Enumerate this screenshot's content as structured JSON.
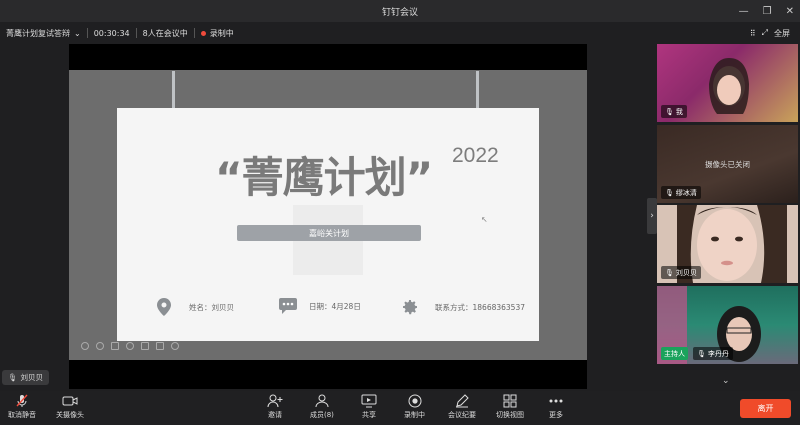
{
  "window": {
    "title": "钉钉会议"
  },
  "infobar": {
    "meeting_name": "菁鹰计划复试答辩",
    "duration": "00:30:34",
    "participants_text": "8人在会议中",
    "recording_text": "录制中",
    "fullscreen_label": "全屏"
  },
  "slide": {
    "title": "“菁鹰计划”",
    "year": "2022",
    "subtitle": "嘉峪关计划",
    "name_text": "姓名：刘贝贝",
    "date_text": "日期：4月28日",
    "contact_text": "联系方式：18668363537"
  },
  "active_speaker": "刘贝贝",
  "participants": [
    {
      "name": "我",
      "camera_off_text": ""
    },
    {
      "name": "缪冰清",
      "camera_off_text": "摄像头已关闭"
    },
    {
      "name": "刘贝贝",
      "camera_off_text": ""
    },
    {
      "name": "李丹丹",
      "host_badge": "主持人",
      "camera_off_text": ""
    }
  ],
  "toolbar": {
    "mute": "取消静音",
    "camera": "关摄像头",
    "invite": "邀请",
    "members": "成员(8)",
    "share": "共享",
    "recording": "录制中",
    "minutes": "会议纪要",
    "switch_view": "切换视图",
    "more": "更多",
    "leave": "离开"
  },
  "colors": {
    "accent": "#f04b2a",
    "host_badge": "#1aa35c",
    "recording_dot": "#f04b3c"
  }
}
